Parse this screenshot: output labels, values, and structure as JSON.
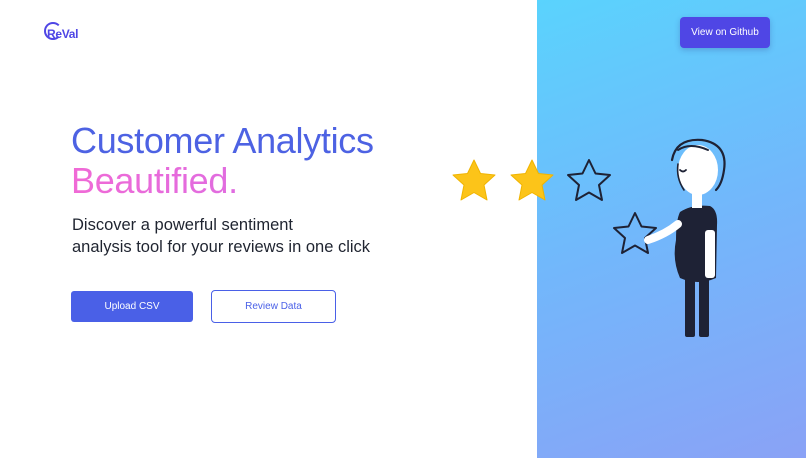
{
  "brand": {
    "logo_text": "ReVal",
    "accent": "#4f46e5",
    "panel_gradient": [
      "#5ad3fd",
      "#8aa2f6"
    ]
  },
  "header": {
    "github_label": "View on Github"
  },
  "hero": {
    "headline_line1": "Customer Analytics",
    "headline_line2": "Beautified.",
    "subtitle_line1": "Discover a powerful sentiment",
    "subtitle_line2": "analysis tool for your reviews in one click",
    "headline_color": "#4d62e3",
    "highlight_color": "#f06ad6"
  },
  "actions": {
    "upload_label": "Upload CSV",
    "review_label": "Review Data"
  },
  "illustration": {
    "stars": [
      {
        "filled": true,
        "icon": "star-filled-icon"
      },
      {
        "filled": true,
        "icon": "star-filled-icon"
      },
      {
        "filled": false,
        "icon": "star-outline-icon"
      },
      {
        "filled": false,
        "icon": "star-outline-icon"
      }
    ],
    "star_fill": "#fcc419",
    "figure_color": "#1e2235"
  }
}
